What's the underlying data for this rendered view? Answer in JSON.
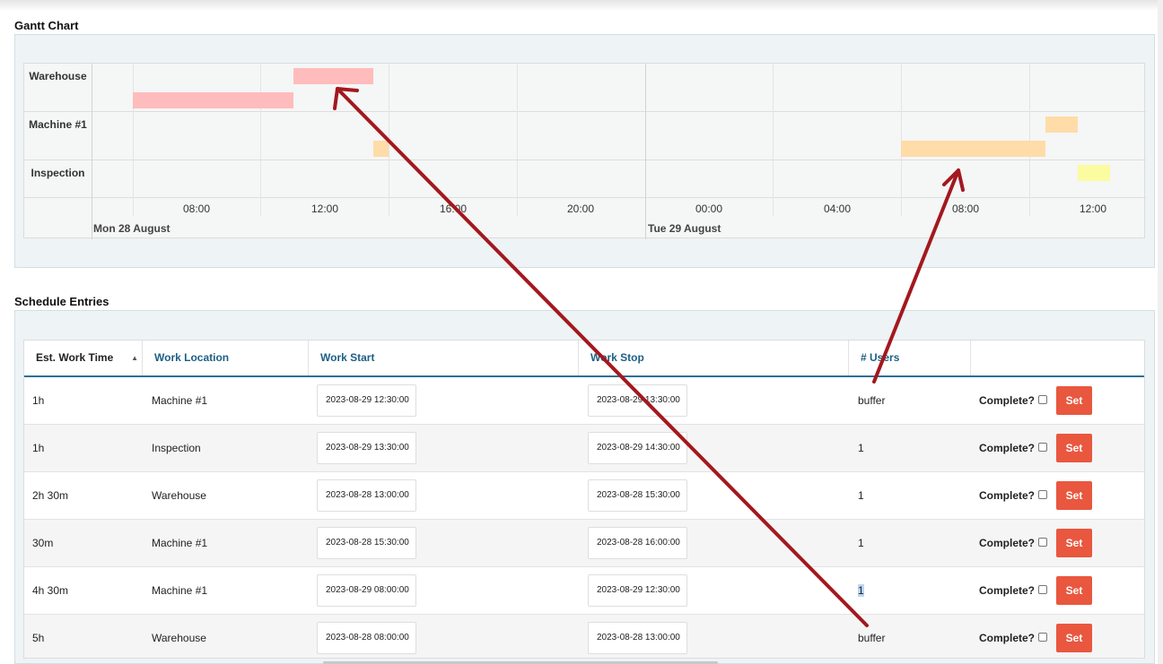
{
  "gantt_section": {
    "title": "Gantt Chart",
    "rows": [
      "Warehouse",
      "Machine #1",
      "Inspection"
    ],
    "time_ticks": [
      "08:00",
      "12:00",
      "16:00",
      "20:00",
      "00:00",
      "04:00",
      "08:00",
      "12:00"
    ],
    "days": [
      "Mon 28 August",
      "Tue 29 August"
    ]
  },
  "schedule_section": {
    "title": "Schedule Entries",
    "columns": [
      "Est. Work Time",
      "Work Location",
      "Work Start",
      "Work Stop",
      "# Users"
    ],
    "rows": [
      {
        "est": "1h",
        "location": "Machine #1",
        "start": "2023-08-29 12:30:00",
        "stop": "2023-08-29 13:30:00",
        "users": "buffer",
        "complete_label": "Complete?",
        "button": "Set"
      },
      {
        "est": "1h",
        "location": "Inspection",
        "start": "2023-08-29 13:30:00",
        "stop": "2023-08-29 14:30:00",
        "users": "1",
        "complete_label": "Complete?",
        "button": "Set"
      },
      {
        "est": "2h 30m",
        "location": "Warehouse",
        "start": "2023-08-28 13:00:00",
        "stop": "2023-08-28 15:30:00",
        "users": "1",
        "complete_label": "Complete?",
        "button": "Set"
      },
      {
        "est": "30m",
        "location": "Machine #1",
        "start": "2023-08-28 15:30:00",
        "stop": "2023-08-28 16:00:00",
        "users": "1",
        "complete_label": "Complete?",
        "button": "Set"
      },
      {
        "est": "4h 30m",
        "location": "Machine #1",
        "start": "2023-08-29 08:00:00",
        "stop": "2023-08-29 12:30:00",
        "users": "1",
        "complete_label": "Complete?",
        "button": "Set"
      },
      {
        "est": "5h",
        "location": "Warehouse",
        "start": "2023-08-28 08:00:00",
        "stop": "2023-08-28 13:00:00",
        "users": "buffer",
        "complete_label": "Complete?",
        "button": "Set"
      }
    ]
  },
  "colors": {
    "warehouse_bar": "#ffbcbc",
    "machine_bar": "#ffdca8",
    "inspection_bar": "#fbfba0",
    "set_button": "#e9573f",
    "header_link": "#1d5f86",
    "annotation_arrow": "#a3181e"
  }
}
